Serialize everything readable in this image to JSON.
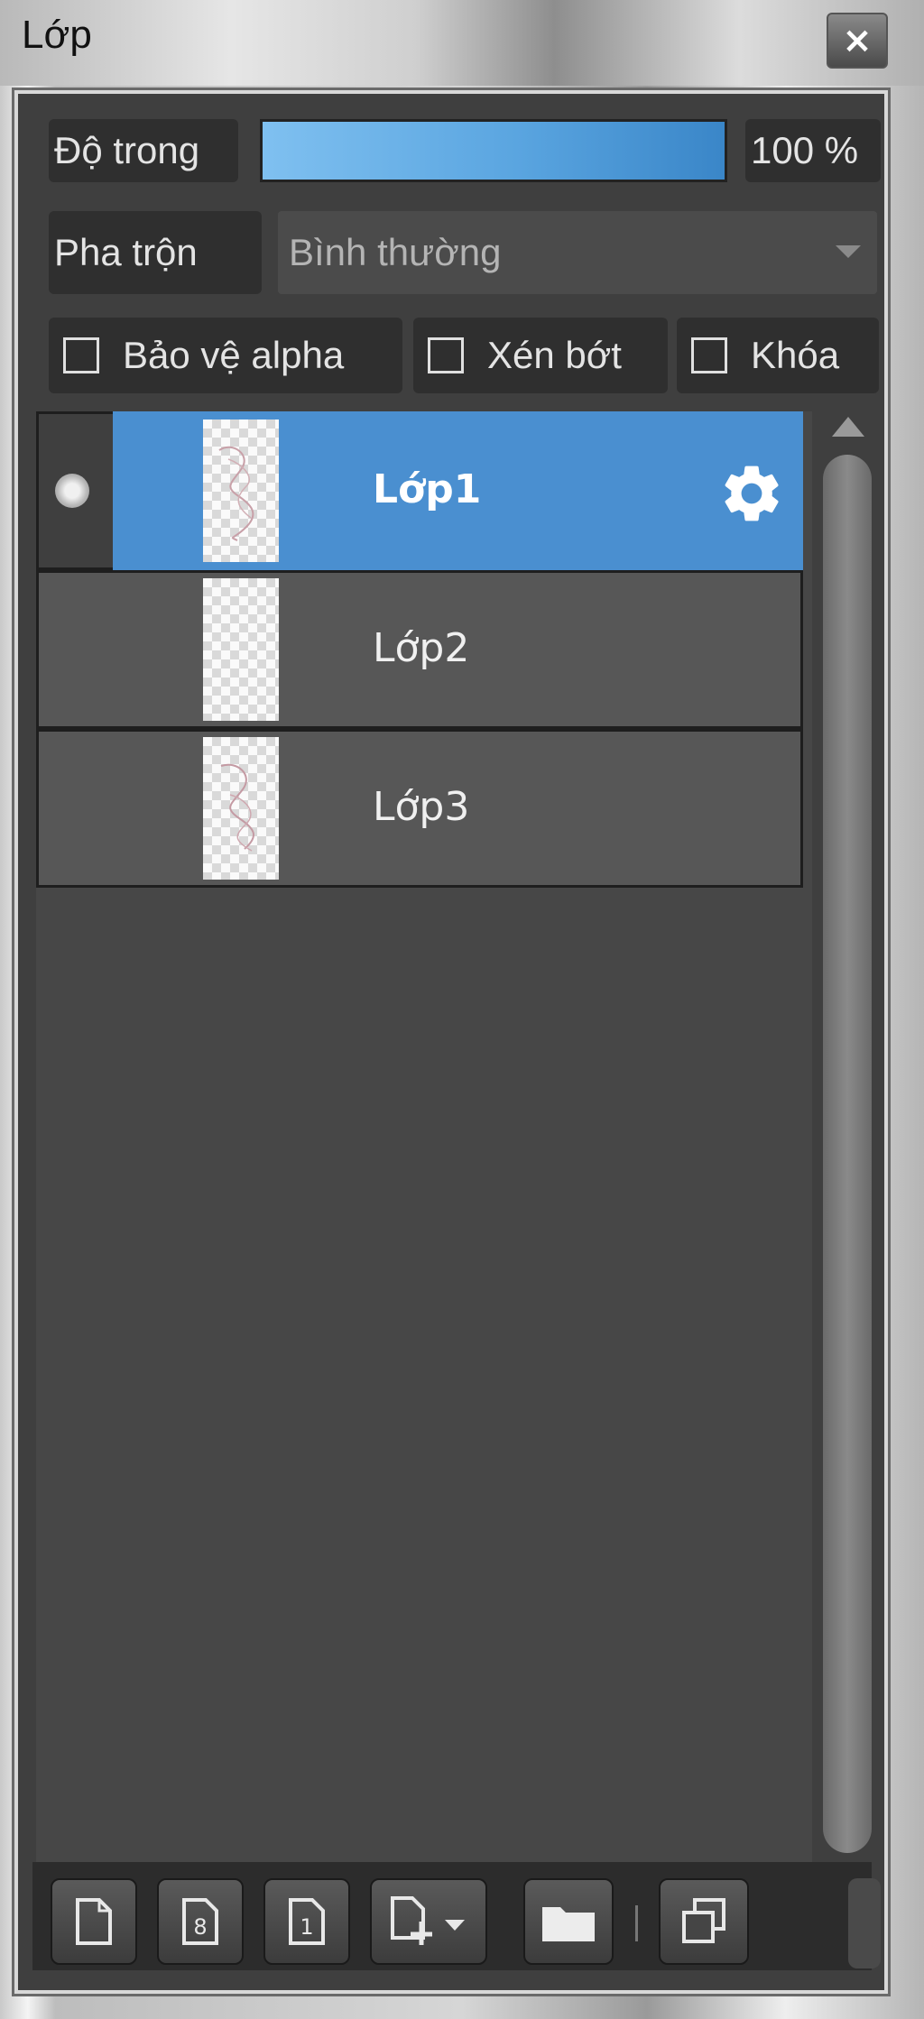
{
  "window": {
    "title": "Lớp",
    "close_label": "×"
  },
  "opacity": {
    "label": "Độ trong",
    "value_text": "100 %",
    "value": 1.0
  },
  "blend": {
    "label": "Pha trộn",
    "selected": "Bình thường"
  },
  "options": [
    {
      "label": "Bảo vệ alpha",
      "checked": false
    },
    {
      "label": "Xén bớt",
      "checked": false
    },
    {
      "label": "Khóa",
      "checked": false
    }
  ],
  "layers": [
    {
      "name": "Lớp1",
      "selected": true,
      "visible": true
    },
    {
      "name": "Lớp2",
      "selected": false,
      "visible": false
    },
    {
      "name": "Lớp3",
      "selected": false,
      "visible": false
    }
  ],
  "toolbar": {
    "buttons": [
      {
        "icon": "new-layer-icon"
      },
      {
        "icon": "8-bit-layer-icon",
        "glyph": "8"
      },
      {
        "icon": "1-bit-layer-icon",
        "glyph": "1"
      },
      {
        "icon": "add-layer-dropdown-icon"
      },
      {
        "icon": "folder-icon"
      },
      {
        "icon": "duplicate-layer-icon"
      }
    ]
  },
  "colors": {
    "selection": "#4a8fd0",
    "panel_bg": "#3f3f3f"
  }
}
